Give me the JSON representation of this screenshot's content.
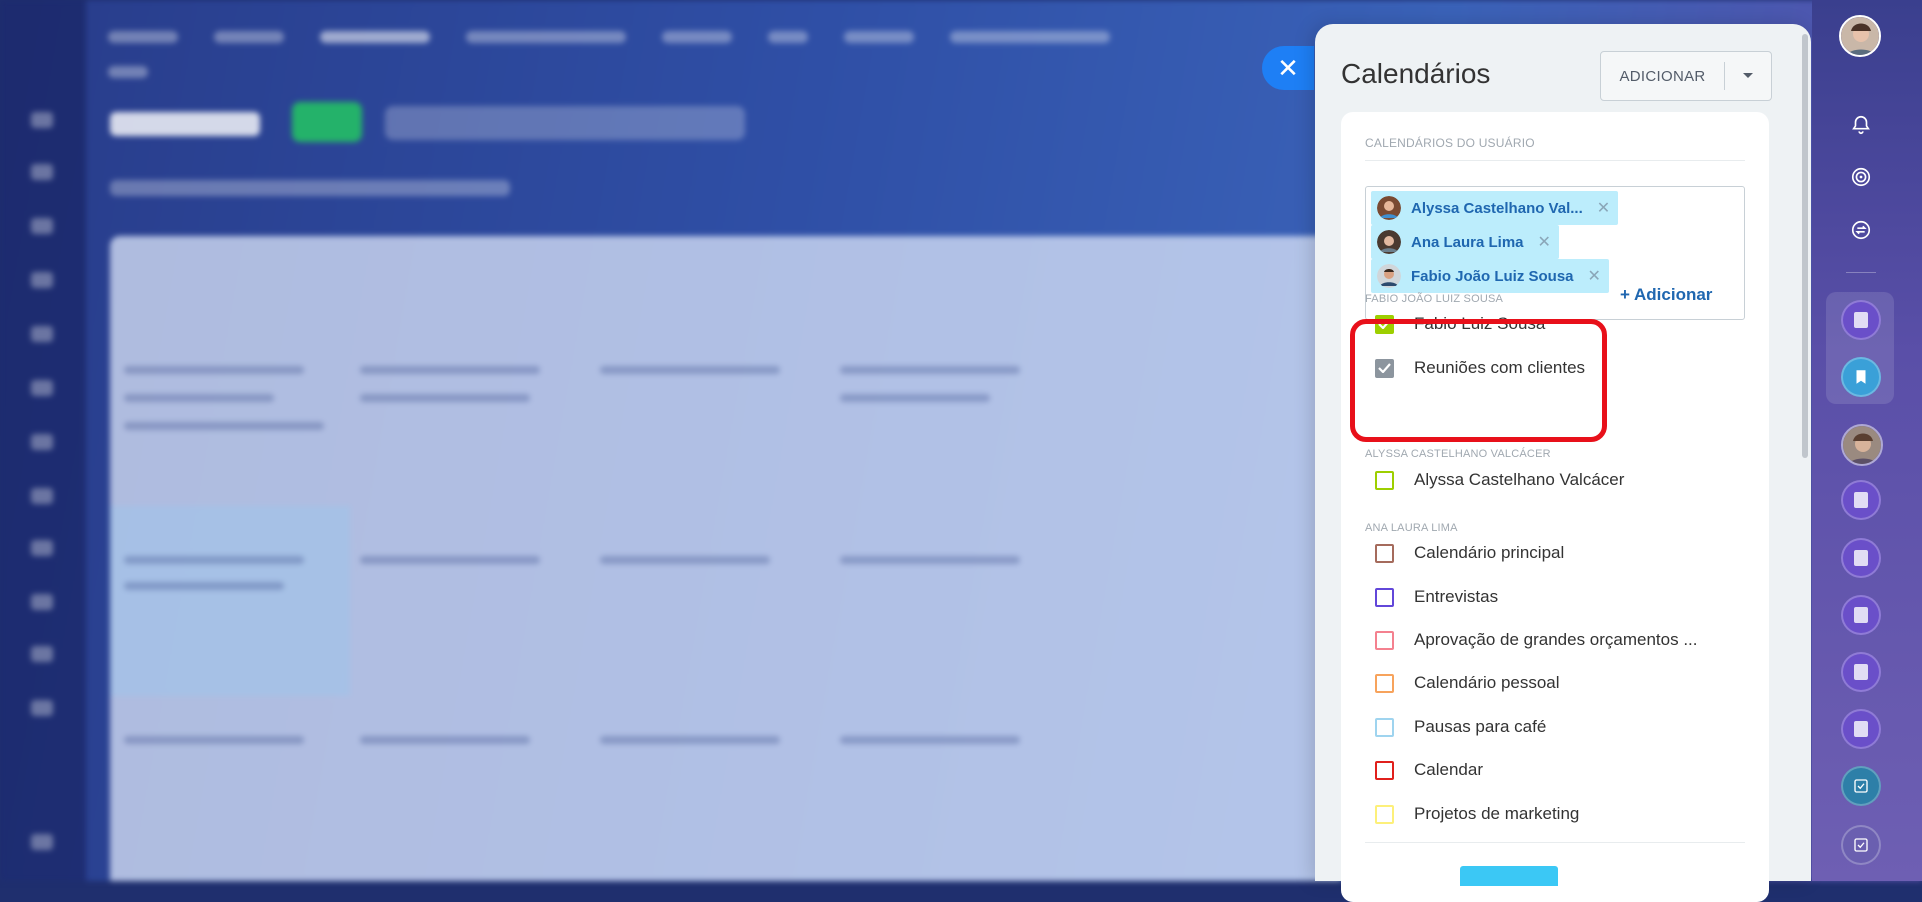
{
  "panel": {
    "title": "Calendários",
    "add_button": "ADICIONAR",
    "user_calendars_header": "CALENDÁRIOS DO USUÁRIO",
    "selected_users": [
      {
        "name": "Alyssa Castelhano Val..."
      },
      {
        "name": "Ana Laura Lima"
      },
      {
        "name": "Fabio João Luiz Sousa"
      }
    ],
    "add_link": "+ Adicionar",
    "groups": [
      {
        "header": "FABIO JOÃO LUIZ SOUSA",
        "calendars": [
          {
            "label": "Fabio Luiz Sousa",
            "checked": true,
            "color": "#9dcf00"
          },
          {
            "label": "Reuniões com clientes",
            "checked": true,
            "color": "#8c959e"
          }
        ]
      },
      {
        "header": "ALYSSA CASTELHANO VALCÁCER",
        "calendars": [
          {
            "label": "Alyssa Castelhano Valcácer",
            "checked": false,
            "color": "#9dcf00"
          }
        ]
      },
      {
        "header": "ANA LAURA LIMA",
        "calendars": [
          {
            "label": "Calendário principal",
            "checked": false,
            "color": "#a56b5c"
          },
          {
            "label": "Entrevistas",
            "checked": false,
            "color": "#6247d9"
          },
          {
            "label": "Aprovação de grandes orçamentos ...",
            "checked": false,
            "color": "#f4818f"
          },
          {
            "label": "Calendário pessoal",
            "checked": false,
            "color": "#f7a35c"
          },
          {
            "label": "Pausas para café",
            "checked": false,
            "color": "#9fd4ef"
          },
          {
            "label": "Calendar",
            "checked": false,
            "color": "#e0201c"
          },
          {
            "label": "Projetos de marketing",
            "checked": false,
            "color": "#fdf07a"
          }
        ]
      }
    ]
  },
  "icons": {
    "close": "close-icon",
    "dropdown": "chevron-down-icon",
    "bell": "bell-icon",
    "target": "target-icon",
    "sync": "sync-icon"
  }
}
